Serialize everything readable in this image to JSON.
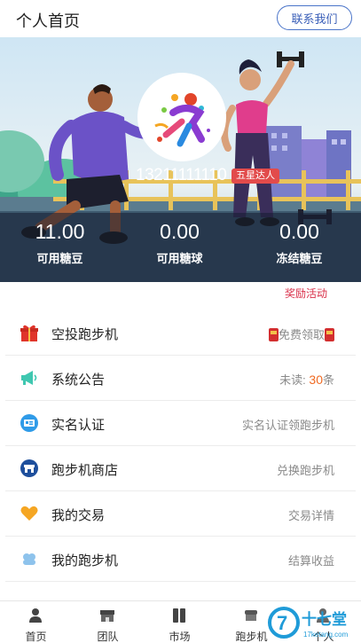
{
  "header": {
    "title": "个人首页",
    "contact_button": "联系我们"
  },
  "profile": {
    "phone": "13211111110",
    "rank_badge": "五星达人",
    "stats": [
      {
        "value": "11.00",
        "label": "可用糖豆"
      },
      {
        "value": "0.00",
        "label": "可用糖球"
      },
      {
        "value": "0.00",
        "label": "冻结糖豆"
      }
    ]
  },
  "reward_link": "奖励活动",
  "menu": [
    {
      "label": "空投跑步机",
      "right": "免费领取",
      "icon": "gift-icon"
    },
    {
      "label": "系统公告",
      "right_prefix": "未读:",
      "right_count": "30",
      "right_suffix": "条",
      "icon": "megaphone-icon"
    },
    {
      "label": "实名认证",
      "right": "实名认证领跑步机",
      "icon": "id-card-icon"
    },
    {
      "label": "跑步机商店",
      "right": "兑换跑步机",
      "icon": "store-icon"
    },
    {
      "label": "我的交易",
      "right": "交易详情",
      "icon": "heart-icon"
    },
    {
      "label": "我的跑步机",
      "right": "结算收益",
      "icon": "treadmill-icon"
    }
  ],
  "tabs": [
    {
      "label": "首页",
      "icon": "user-icon"
    },
    {
      "label": "团队",
      "icon": "shop-icon"
    },
    {
      "label": "市场",
      "icon": "columns-icon"
    },
    {
      "label": "跑步机",
      "icon": "treadmill-icon"
    },
    {
      "label": "个人",
      "icon": "person-icon"
    }
  ],
  "watermark": {
    "text": "十七堂",
    "sub": "17ketang.com"
  },
  "colors": {
    "accent": "#3a5fb8",
    "badge": "#e24b4b",
    "count": "#f06a22",
    "reward": "#d9304a"
  }
}
